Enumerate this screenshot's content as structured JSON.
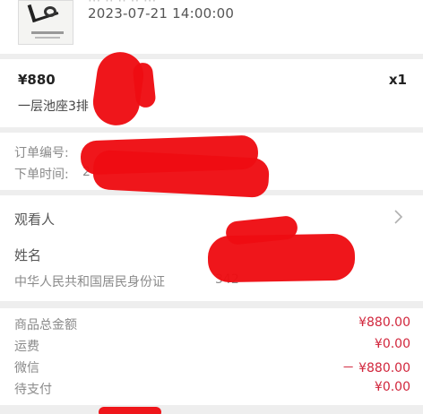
{
  "show": {
    "title_partial": "··· ·· ·· ·· ···",
    "datetime": "2023-07-21 14:00:00"
  },
  "ticket": {
    "price": "¥880",
    "quantity": "x1",
    "seat_partial": "一层池座3排"
  },
  "order": {
    "number_label": "订单编号:",
    "time_label": "下单时间:",
    "time_partial": "2"
  },
  "viewer": {
    "section_title": "观看人",
    "name_label": "姓名",
    "id_type": "中华人民共和国居民身份证",
    "id_partial": "342"
  },
  "summary": {
    "rows": [
      {
        "label": "商品总金额",
        "value": "¥880.00"
      },
      {
        "label": "运费",
        "value": "¥0.00"
      },
      {
        "label": "微信",
        "value": "－ ¥880.00"
      },
      {
        "label": "待支付",
        "value": "¥0.00"
      }
    ]
  },
  "colors": {
    "accent_red": "#d1263c",
    "redaction": "#ee0c12",
    "background": "#eeeeee"
  },
  "icons": {
    "chevron": "chevron-right-icon"
  }
}
